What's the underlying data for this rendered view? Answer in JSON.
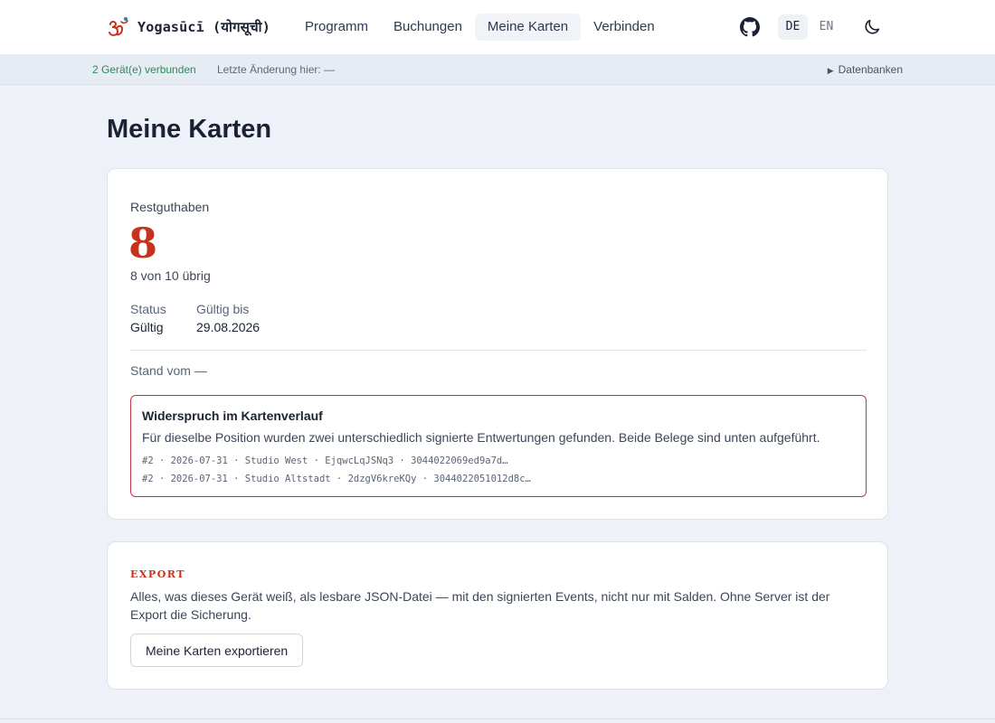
{
  "header": {
    "app_name": "Yogasūcī (योगसूची)",
    "logo_icon": "om-logo-icon",
    "nav": [
      {
        "label": "Programm",
        "active": false
      },
      {
        "label": "Buchungen",
        "active": false
      },
      {
        "label": "Meine Karten",
        "active": true
      },
      {
        "label": "Verbinden",
        "active": false
      }
    ],
    "github_icon": "github-icon",
    "languages": [
      {
        "label": "DE",
        "active": true
      },
      {
        "label": "EN",
        "active": false
      }
    ],
    "theme_icon": "moon-icon"
  },
  "statusbar": {
    "sync_status": "2 Gerät(e) verbunden",
    "last_change": "Letzte Änderung hier: —",
    "db_toggle": "Datenbanken",
    "sync_color": "#2e8b57"
  },
  "page": {
    "title": "Meine Karten"
  },
  "card": {
    "balance_label": "Restguthaben",
    "balance_value": "8",
    "balance_sub": "8 von 10 übrig",
    "remaining": 8,
    "total": 10,
    "status_label": "Status",
    "status_value": "Gültig",
    "valid_until_label": "Gültig bis",
    "valid_until_value": "29.08.2026",
    "stand": "Stand vom —",
    "accent_color": "#c6331d"
  },
  "conflict": {
    "title": "Widerspruch im Kartenverlauf",
    "description": "Für dieselbe Position wurden zwei unterschiedlich signierte Entwertungen gefunden. Beide Belege sind unten aufgeführt.",
    "entries": [
      "#2 · 2026-07-31 · Studio West · EjqwcLqJSNq3 · 3044022069ed9a7d…",
      "#2 · 2026-07-31 · Studio Altstadt · 2dzgV6kreKQy · 3044022051012d8c…"
    ],
    "border_color": "#c8334a"
  },
  "export": {
    "kicker": "EXPORT",
    "description": "Alles, was dieses Gerät weiß, als lesbare JSON-Datei — mit den signierten Events, nicht nur mit Salden. Ohne Server ist der Export die Sicherung.",
    "button_label": "Meine Karten exportieren"
  }
}
